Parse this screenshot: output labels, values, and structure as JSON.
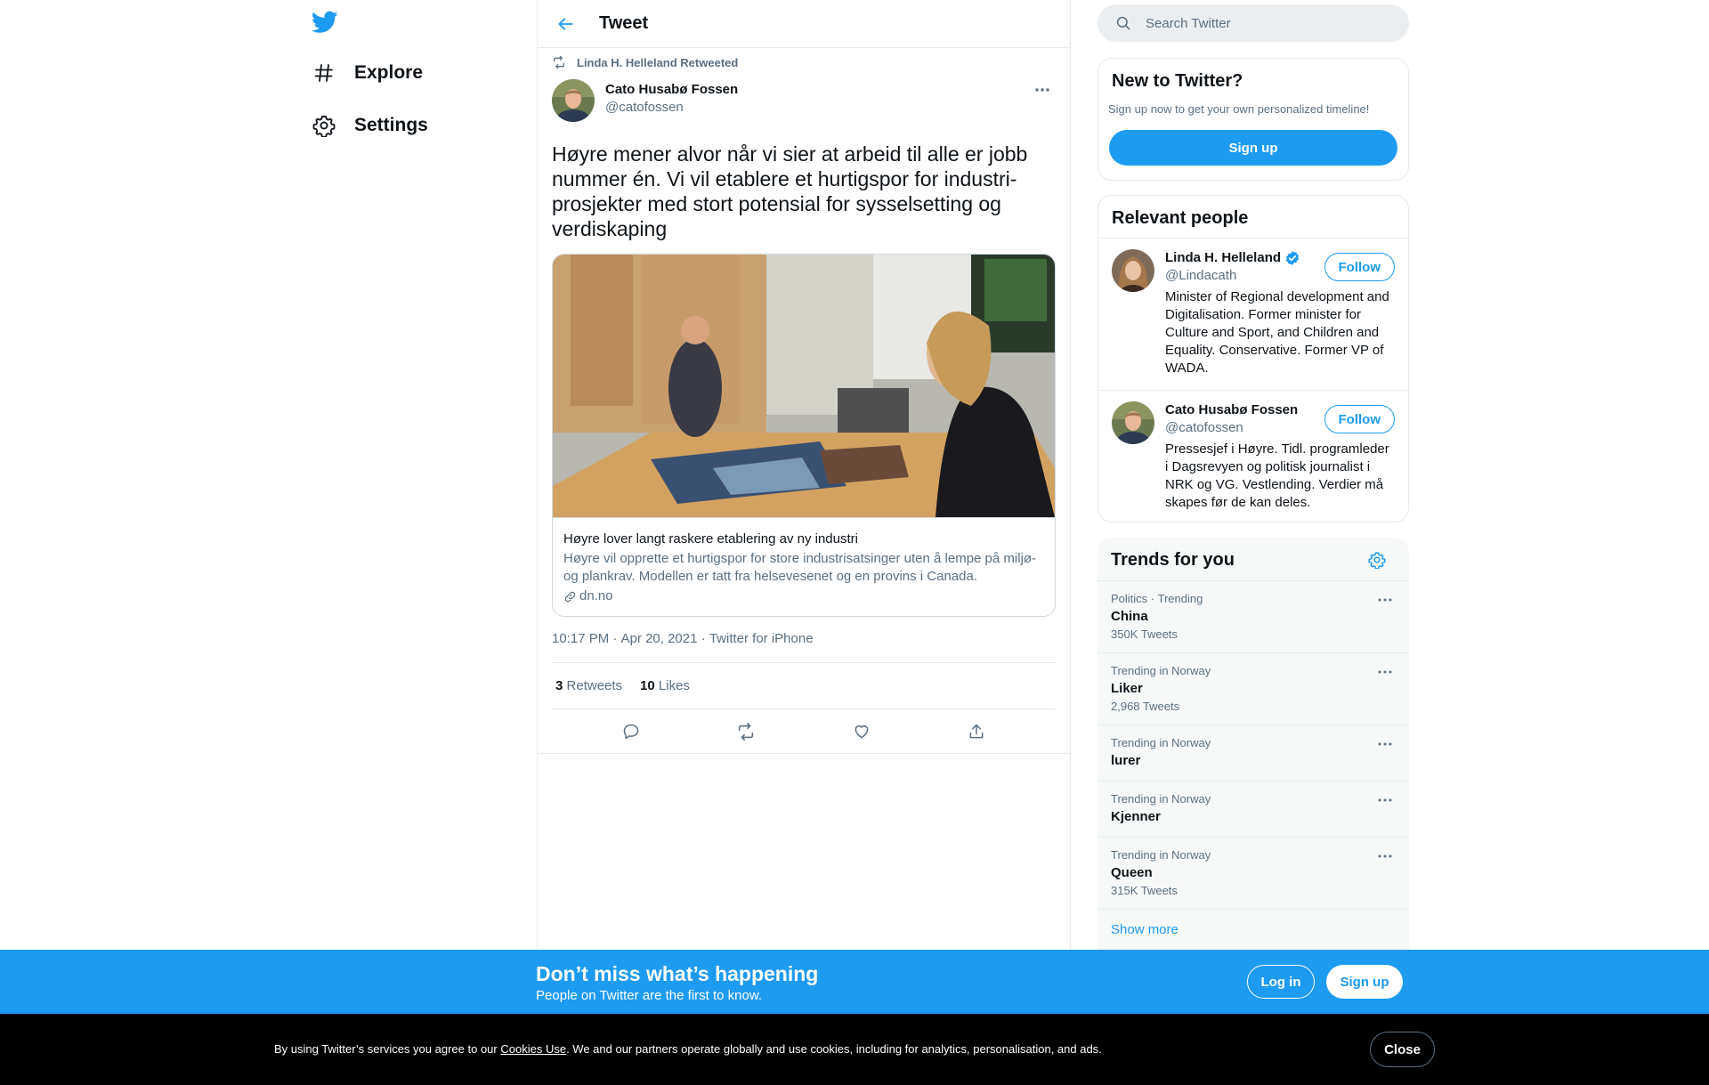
{
  "nav": {
    "logo": "twitter-bird-icon",
    "items": [
      {
        "label": "Explore",
        "icon": "hashtag-icon"
      },
      {
        "label": "Settings",
        "icon": "gear-icon"
      }
    ]
  },
  "header": {
    "title": "Tweet"
  },
  "tweet": {
    "retweeted_by": "Linda H. Helleland Retweeted",
    "author_name": "Cato Husabø Fossen",
    "author_handle": "@catofossen",
    "text": "Høyre mener alvor når vi sier at arbeid til alle er jobb nummer én. Vi vil etablere et hurtigspor for industri-prosjekter med stort potensial for sysselsetting og verdiskaping",
    "card": {
      "title": "Høyre lover langt raskere etablering av ny industri",
      "description": "Høyre vil opprette et hurtigspor for store industrisatsinger uten å lempe på miljø- og plankrav. Modellen er tatt fra helsevesenet og en provins i Canada.",
      "domain": "dn.no"
    },
    "time": "10:17 PM",
    "date": "Apr 20, 2021",
    "source": "Twitter for iPhone",
    "separator": " · ",
    "retweets_count": "3",
    "retweets_label": "Retweets",
    "likes_count": "10",
    "likes_label": "Likes"
  },
  "search": {
    "placeholder": "Search Twitter"
  },
  "new_to_twitter": {
    "title": "New to Twitter?",
    "subtitle": "Sign up now to get your own personalized timeline!",
    "button": "Sign up"
  },
  "relevant_people": {
    "title": "Relevant people",
    "people": [
      {
        "name": "Linda H. Helleland",
        "handle": "@Lindacath",
        "verified": true,
        "bio": "Minister of Regional development and Digitalisation. Former minister for Culture and Sport, and Children and Equality. Conservative. Former VP of WADA.",
        "follow": "Follow"
      },
      {
        "name": "Cato Husabø Fossen",
        "handle": "@catofossen",
        "verified": false,
        "bio": "Pressesjef i Høyre. Tidl. programleder i Dagsrevyen og politisk journalist i NRK og VG. Vestlending. Verdier må skapes før de kan deles.",
        "follow": "Follow"
      }
    ]
  },
  "trends": {
    "title": "Trends for you",
    "items": [
      {
        "context": "Politics · Trending",
        "name": "China",
        "count": "350K Tweets"
      },
      {
        "context": "Trending in Norway",
        "name": "Liker",
        "count": "2,968 Tweets"
      },
      {
        "context": "Trending in Norway",
        "name": "lurer",
        "count": ""
      },
      {
        "context": "Trending in Norway",
        "name": "Kjenner",
        "count": ""
      },
      {
        "context": "Trending in Norway",
        "name": "Queen",
        "count": "315K Tweets"
      }
    ],
    "show_more": "Show more"
  },
  "banner": {
    "title": "Don’t miss what’s happening",
    "subtitle": "People on Twitter are the first to know.",
    "login": "Log in",
    "signup": "Sign up"
  },
  "cookie": {
    "text_before": "By using Twitter’s services you agree to our ",
    "link": "Cookies Use",
    "text_after": ". We and our partners operate globally and use cookies, including for analytics, personalisation, and ads.",
    "close": "Close"
  },
  "colors": {
    "accent": "#1d9bf0",
    "secondary_text": "#5b7083",
    "border": "#e6ecf0",
    "cookie_bg": "#000000"
  }
}
